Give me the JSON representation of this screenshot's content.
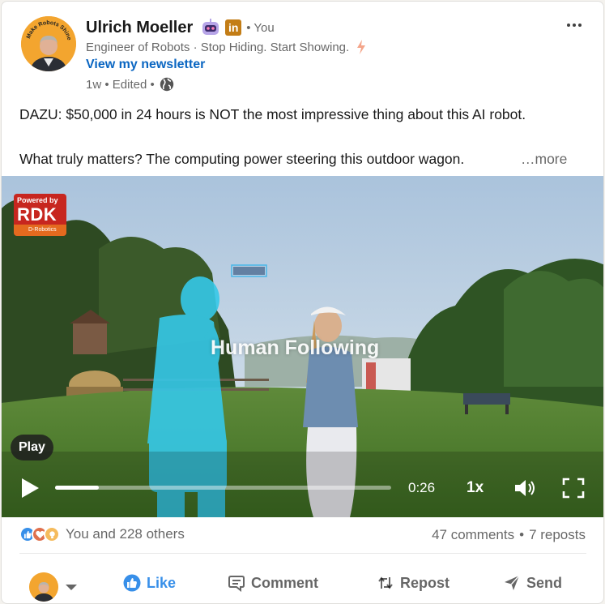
{
  "post": {
    "author": {
      "name": "Ulrich Moeller",
      "you_label": "• You",
      "avatar_text": "Make Robots Shine",
      "headline": "Engineer of Robots · Stop Hiding. Start Showing.",
      "newsletter_link": "View my newsletter",
      "meta": "1w • Edited •"
    },
    "text_line1": "DAZU: $50,000 in 24 hours is NOT the most impressive thing about this AI robot.",
    "text_line2": "What truly matters? The computing power steering this outdoor wagon.",
    "more_label": "…more"
  },
  "video": {
    "badge_powered": "Powered by",
    "badge_brand": "RDK",
    "badge_sub": "D-Robotics",
    "overlay_caption": "Human Following",
    "play_tooltip": "Play",
    "progress_fraction": 0.13,
    "time": "0:26",
    "speed": "1x"
  },
  "social": {
    "reactions_label": "You and 228 others",
    "comments": "47 comments",
    "separator": "•",
    "reposts": "7 reposts"
  },
  "actions": {
    "like": "Like",
    "comment": "Comment",
    "repost": "Repost",
    "send": "Send"
  },
  "colors": {
    "link_blue": "#0a66c2",
    "like_blue": "#378fe9",
    "linkedin_badge": "#c37d16",
    "rdk_red": "#c7261f"
  },
  "icons": [
    "robot-badge-icon",
    "linkedin-badge-icon",
    "bolt-icon",
    "globe-icon",
    "more-options-icon",
    "play-icon",
    "volume-icon",
    "fullscreen-icon",
    "like-reaction-icon",
    "love-reaction-icon",
    "insightful-reaction-icon",
    "thumbs-up-icon",
    "comment-icon",
    "repost-icon",
    "send-icon",
    "caret-down-icon"
  ]
}
